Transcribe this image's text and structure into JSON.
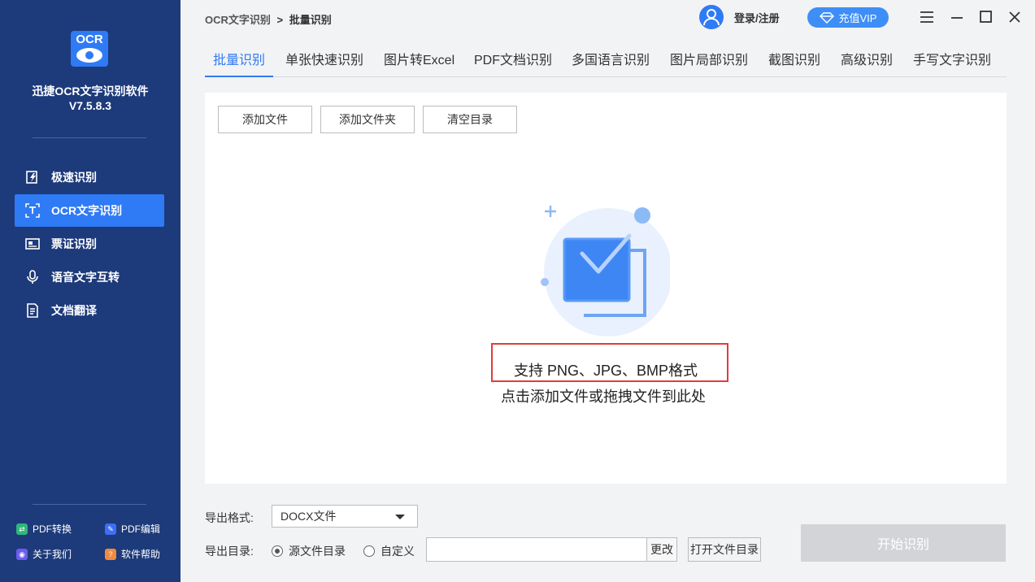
{
  "sidebar": {
    "logo_text": "OCR",
    "app_name": "迅捷OCR文字识别软件",
    "version": "V7.5.8.3",
    "items": [
      {
        "label": "极速识别",
        "icon": "lightning-doc-icon"
      },
      {
        "label": "OCR文字识别",
        "icon": "text-scan-icon",
        "active": true
      },
      {
        "label": "票证识别",
        "icon": "ticket-icon"
      },
      {
        "label": "语音文字互转",
        "icon": "microphone-icon"
      },
      {
        "label": "文档翻译",
        "icon": "translate-doc-icon"
      }
    ],
    "footer": [
      {
        "label": "PDF转换",
        "icon": "pdf-convert-icon",
        "color": "#2fb67a"
      },
      {
        "label": "PDF编辑",
        "icon": "pdf-edit-icon",
        "color": "#3e6ef7"
      },
      {
        "label": "关于我们",
        "icon": "about-icon",
        "color": "#6a5cf0"
      },
      {
        "label": "软件帮助",
        "icon": "help-icon",
        "color": "#f08a3c"
      }
    ]
  },
  "header": {
    "breadcrumb_root": "OCR文字识别",
    "breadcrumb_sep": ">",
    "breadcrumb_current": "批量识别",
    "login_label": "登录/注册",
    "vip_label": "充值VIP"
  },
  "tabs": [
    "批量识别",
    "单张快速识别",
    "图片转Excel",
    "PDF文档识别",
    "多国语言识别",
    "图片局部识别",
    "截图识别",
    "高级识别",
    "手写文字识别"
  ],
  "toolbar": {
    "add_file": "添加文件",
    "add_folder": "添加文件夹",
    "clear_list": "清空目录"
  },
  "dropzone": {
    "support_text": "支持 PNG、JPG、BMP格式",
    "hint_text": "点击添加文件或拖拽文件到此处"
  },
  "export": {
    "format_label": "导出格式:",
    "format_value": "DOCX文件",
    "dir_label": "导出目录:",
    "option_source": "源文件目录",
    "option_custom": "自定义",
    "selected_option": "源文件目录",
    "path_value": "",
    "change_label": "更改",
    "open_dir_label": "打开文件目录",
    "start_label": "开始识别"
  },
  "colors": {
    "sidebar_bg": "#1d3a7a",
    "accent": "#2f7af5",
    "highlight_box": "#e23b3b",
    "disabled_btn": "#d2d4d7"
  }
}
